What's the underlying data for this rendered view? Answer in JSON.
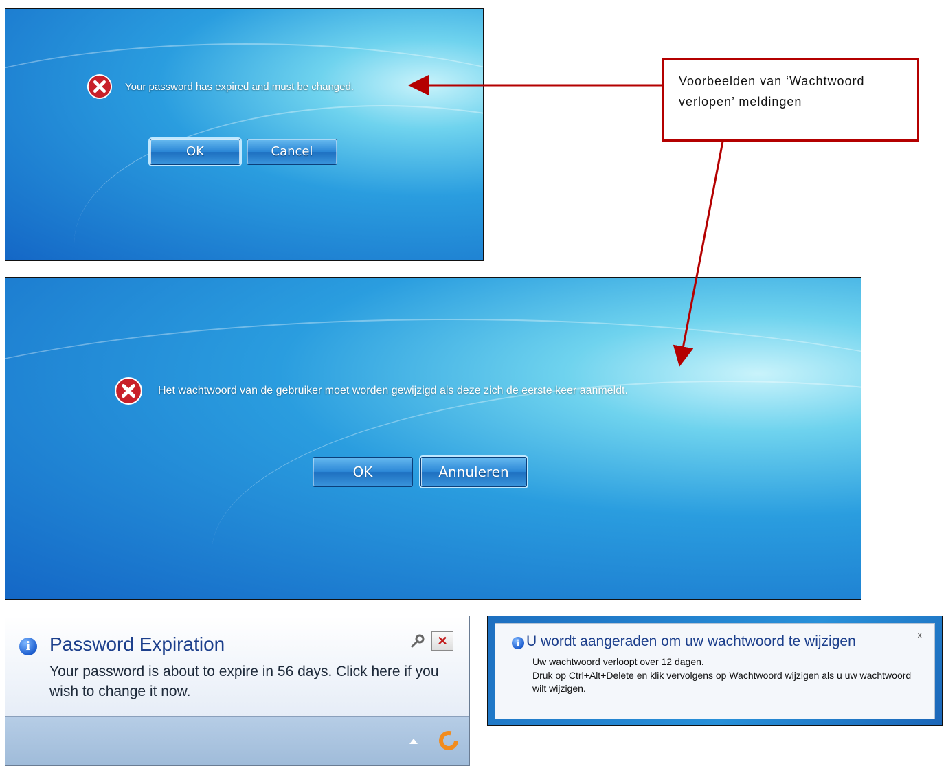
{
  "callout": {
    "text": "Voorbeelden van ‘Wachtwoord verlopen’ meldingen",
    "border_color": "#b40000"
  },
  "dialog_en": {
    "message": "Your password has expired and must be changed.",
    "ok_label": "OK",
    "cancel_label": "Cancel",
    "icon": "error-icon"
  },
  "dialog_nl": {
    "message": "Het wachtwoord van de gebruiker moet worden gewijzigd als deze zich de eerste keer aanmeldt.",
    "ok_label": "OK",
    "cancel_label": "Annuleren",
    "icon": "error-icon"
  },
  "balloon_en": {
    "title": "Password Expiration",
    "body": "Your password is about to expire in 56 days. Click here if you wish to change it now.",
    "close_symbol": "✕",
    "icon": "info-icon"
  },
  "balloon_nl": {
    "title": "U wordt aangeraden om uw wachtwoord te wijzigen",
    "line1": "Uw wachtwoord verloopt over 12 dagen.",
    "line2": "Druk op Ctrl+Alt+Delete en klik vervolgens op Wachtwoord wijzigen als u uw wachtwoord wilt wijzigen.",
    "close_symbol": "x",
    "icon": "info-icon"
  },
  "colors": {
    "desktop_blue": "#1467c6",
    "error_red": "#c8202a",
    "info_blue": "#1e5fd0"
  }
}
